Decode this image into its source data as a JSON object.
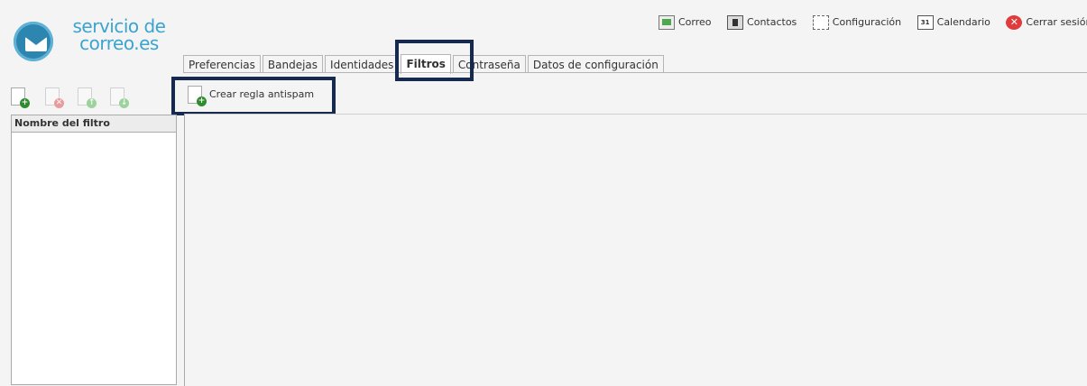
{
  "logo": {
    "line1": "servicio de",
    "line2": "correo.es"
  },
  "topnav": [
    {
      "label": "Correo",
      "icon": "mail-icon"
    },
    {
      "label": "Contactos",
      "icon": "contacts-icon"
    },
    {
      "label": "Configuración",
      "icon": "settings-icon"
    },
    {
      "label": "Calendario",
      "icon": "calendar-icon",
      "icon_text": "31"
    },
    {
      "label": "Cerrar sesión",
      "icon": "close-icon"
    }
  ],
  "tabs": [
    {
      "label": "Preferencias"
    },
    {
      "label": "Bandejas"
    },
    {
      "label": "Identidades"
    },
    {
      "label": "Filtros",
      "active": true
    },
    {
      "label": "Contraseña"
    },
    {
      "label": "Datos de configuración"
    }
  ],
  "toolbar": {
    "create_antispam_label": "Crear regla antispam"
  },
  "filters_panel": {
    "header": "Nombre del filtro",
    "items": []
  },
  "colors": {
    "highlight": "#152a4e",
    "brand": "#3aa4cf"
  }
}
